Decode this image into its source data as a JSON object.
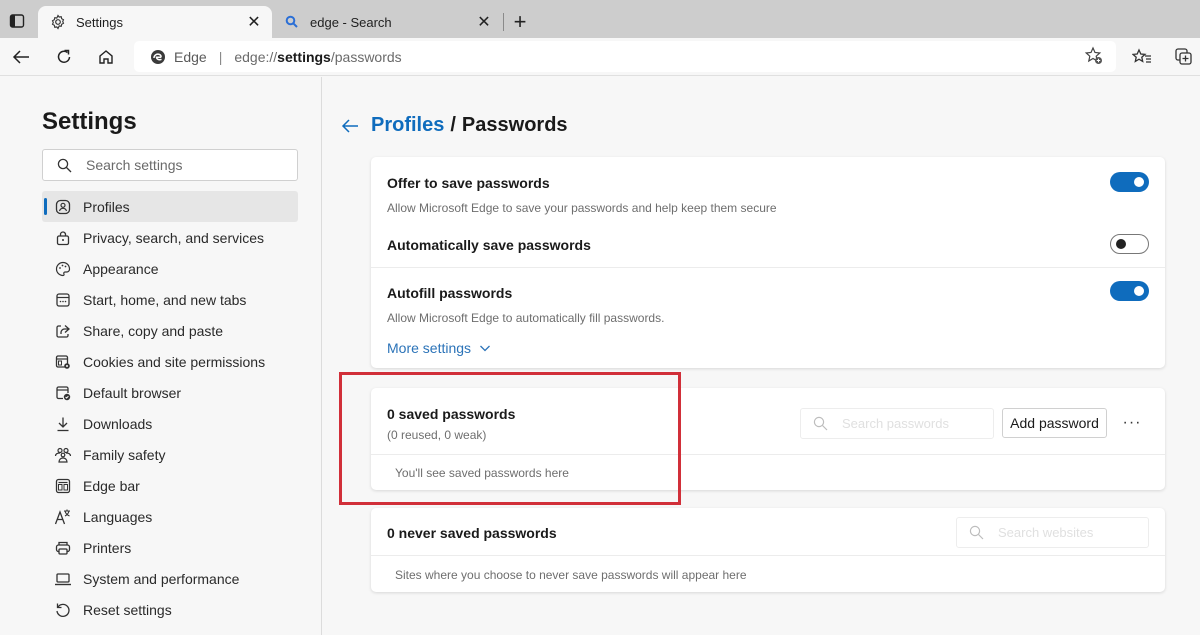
{
  "browser": {
    "tabs": [
      {
        "title": "Settings",
        "icon": "gear-icon",
        "active": true
      },
      {
        "title": "edge - Search",
        "icon": "search-icon",
        "active": false
      }
    ],
    "address": {
      "brand": "Edge",
      "url_prefix": "edge://",
      "url_bold": "settings",
      "url_suffix": "/passwords"
    }
  },
  "sidebar": {
    "title": "Settings",
    "search_placeholder": "Search settings",
    "items": [
      {
        "label": "Profiles",
        "icon": "profile-icon",
        "active": true
      },
      {
        "label": "Privacy, search, and services",
        "icon": "lock-icon"
      },
      {
        "label": "Appearance",
        "icon": "palette-icon"
      },
      {
        "label": "Start, home, and new tabs",
        "icon": "new-tab-icon"
      },
      {
        "label": "Share, copy and paste",
        "icon": "share-icon"
      },
      {
        "label": "Cookies and site permissions",
        "icon": "cookies-icon"
      },
      {
        "label": "Default browser",
        "icon": "default-browser-icon"
      },
      {
        "label": "Downloads",
        "icon": "download-icon"
      },
      {
        "label": "Family safety",
        "icon": "family-icon"
      },
      {
        "label": "Edge bar",
        "icon": "edge-bar-icon"
      },
      {
        "label": "Languages",
        "icon": "languages-icon"
      },
      {
        "label": "Printers",
        "icon": "printer-icon"
      },
      {
        "label": "System and performance",
        "icon": "laptop-icon"
      },
      {
        "label": "Reset settings",
        "icon": "reset-icon"
      }
    ]
  },
  "main": {
    "breadcrumb": {
      "parent": "Profiles",
      "separator": "/",
      "current": "Passwords"
    },
    "settings": {
      "offer_save": {
        "title": "Offer to save passwords",
        "desc": "Allow Microsoft Edge to save your passwords and help keep them secure",
        "enabled": true
      },
      "auto_save": {
        "title": "Automatically save passwords",
        "enabled": false
      },
      "autofill": {
        "title": "Autofill passwords",
        "desc": "Allow Microsoft Edge to automatically fill passwords.",
        "enabled": true
      },
      "more_settings": "More settings"
    },
    "saved": {
      "title": "0 saved passwords",
      "subtitle": "(0 reused, 0 weak)",
      "search_placeholder": "Search passwords",
      "add_button": "Add password",
      "more_button": "···",
      "empty": "You'll see saved passwords here"
    },
    "never_saved": {
      "title": "0 never saved passwords",
      "search_placeholder": "Search websites",
      "empty": "Sites where you choose to never save passwords will appear here"
    }
  },
  "annotation": {
    "highlight_color": "#d12f39"
  },
  "colors": {
    "accent": "#0f6cbd"
  }
}
